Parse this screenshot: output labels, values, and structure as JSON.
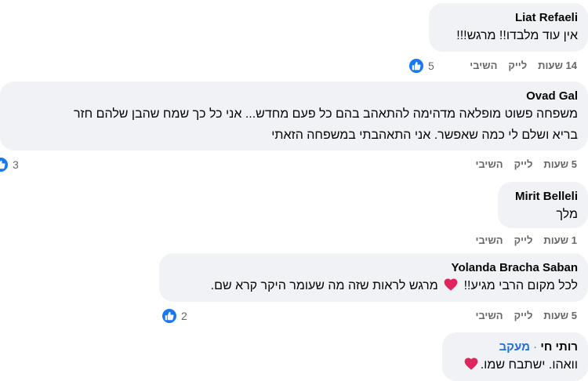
{
  "comments": [
    {
      "author": "Liat Refaeli",
      "text": "אין עוד מלבדו!! מרגש!!!",
      "time": "14 שעות",
      "like_label": "לייק",
      "reply_label": "השיבי",
      "reactions": "5"
    },
    {
      "author": "Ovad Gal",
      "text_line1": "משפחה פשוט מופלאה מדהימה להתאהב בהם כל פעם מחדש... אני כל כך שמח שהבן שלהם חזר",
      "text_line2": "בריא ושלם לי כמה שאפשר. אני התאהבתי במשפחה הזאתי",
      "time": "5 שעות",
      "like_label": "לייק",
      "reply_label": "השיבי",
      "reactions": "3"
    },
    {
      "author": "Mirit Belleli",
      "text": "מלך",
      "time": "1 שעות",
      "like_label": "לייק",
      "reply_label": "השיבי"
    },
    {
      "author": "Yolanda Bracha Saban",
      "text_before_heart": "לכל מקום הרבי מגיע!!",
      "text_after_heart": "מרגש לראות שזה מה שעומר היקר קרא שם.",
      "time": "5 שעות",
      "like_label": "לייק",
      "reply_label": "השיבי",
      "reactions": "2"
    },
    {
      "author": "רותי חי",
      "follow_separator": "·",
      "follow_label": "מעקב",
      "text": "וואהו. ישתבח שמו.",
      "time": "",
      "like_label": "",
      "reply_label": ""
    }
  ],
  "colors": {
    "bubble": "#f0f2f5",
    "meta": "#65676b",
    "like_blue": "#1877f2",
    "heart_red": "#e0245e",
    "follow_blue": "#216fdb"
  },
  "icons": [
    "like-reaction-icon",
    "heart-emoji-icon"
  ]
}
